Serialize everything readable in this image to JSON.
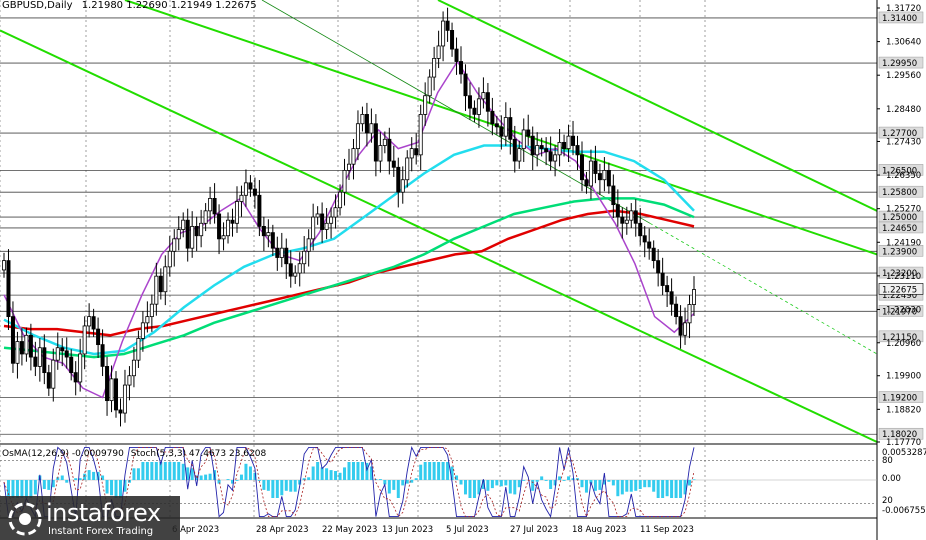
{
  "header": {
    "symbol": "GBPUSD,Daily",
    "ohlc": "1.21980 1.22690 1.21949 1.22675"
  },
  "subwindow": {
    "osma": "OsMA(12,26,9) -0.0009790",
    "stoch": "Stoch(5,3,3) 47.4673 23.6208"
  },
  "logo": {
    "name": "instaforex",
    "tagline": "Instant Forex Trading"
  },
  "colors": {
    "green_channel": "#22dd00",
    "ma_red": "#e00000",
    "ma_green": "#00dd77",
    "ma_cyan": "#22ddee",
    "ma_violet": "#aa44cc",
    "osma_bars": "#33ccee",
    "stoch_main": "#2222aa",
    "stoch_signal": "#aa2222",
    "current_price_bg": "#f0f0f0"
  },
  "chart_data": {
    "type": "candlestick",
    "symbol": "GBPUSD",
    "timeframe": "Daily",
    "price_axis_ticks": [
      "1.31720",
      "1.30640",
      "1.29560",
      "1.28480",
      "1.27430",
      "1.26350",
      "1.25270",
      "1.24190",
      "1.23110",
      "1.22030",
      "1.20960",
      "1.19900",
      "1.18820",
      "1.17770"
    ],
    "level_labels": [
      "1.31400",
      "1.29950",
      "1.27700",
      "1.26500",
      "1.25800",
      "1.25000",
      "1.24650",
      "1.23900",
      "1.23200",
      "1.22490",
      "1.21970",
      "1.21150",
      "1.19200",
      "1.18020"
    ],
    "current_price": "1.22675",
    "date_axis_ticks": [
      "6 Apr 2023",
      "28 Apr 2023",
      "22 May 2023",
      "13 Jun 2023",
      "5 Jul 2023",
      "27 Jul 2023",
      "18 Aug 2023",
      "11 Sep 2023"
    ],
    "subwindow_axis_ticks": [
      "0.0053287",
      "80",
      "0.00",
      "20",
      "-0.006755"
    ],
    "stoch_levels": [
      80,
      20
    ],
    "closes": [
      1.236,
      1.218,
      1.203,
      1.21,
      1.206,
      1.212,
      1.205,
      1.202,
      1.208,
      1.2,
      1.195,
      1.204,
      1.208,
      1.207,
      1.205,
      1.2,
      1.197,
      1.206,
      1.215,
      1.218,
      1.214,
      1.209,
      1.202,
      1.191,
      1.198,
      1.188,
      1.187,
      1.196,
      1.199,
      1.204,
      1.211,
      1.216,
      1.218,
      1.222,
      1.231,
      1.226,
      1.234,
      1.239,
      1.243,
      1.246,
      1.249,
      1.24,
      1.247,
      1.244,
      1.248,
      1.252,
      1.256,
      1.251,
      1.243,
      1.244,
      1.249,
      1.248,
      1.255,
      1.257,
      1.261,
      1.259,
      1.257,
      1.247,
      1.244,
      1.245,
      1.24,
      1.237,
      1.24,
      1.235,
      1.231,
      1.232,
      1.235,
      1.239,
      1.243,
      1.25,
      1.251,
      1.246,
      1.248,
      1.25,
      1.253,
      1.258,
      1.265,
      1.267,
      1.272,
      1.28,
      1.283,
      1.277,
      1.28,
      1.268,
      1.273,
      1.275,
      1.268,
      1.266,
      1.258,
      1.262,
      1.269,
      1.272,
      1.27,
      1.283,
      1.289,
      1.295,
      1.301,
      1.305,
      1.313,
      1.31,
      1.304,
      1.3,
      1.296,
      1.289,
      1.285,
      1.283,
      1.288,
      1.29,
      1.284,
      1.28,
      1.279,
      1.276,
      1.282,
      1.275,
      1.268,
      1.272,
      1.278,
      1.276,
      1.27,
      1.273,
      1.272,
      1.271,
      1.268,
      1.27,
      1.274,
      1.272,
      1.276,
      1.273,
      1.27,
      1.262,
      1.26,
      1.268,
      1.264,
      1.262,
      1.265,
      1.26,
      1.254,
      1.25,
      1.248,
      1.249,
      1.252,
      1.248,
      1.244,
      1.242,
      1.24,
      1.236,
      1.232,
      1.228,
      1.226,
      1.222,
      1.218,
      1.212,
      1.216,
      1.2219,
      1.2267
    ],
    "series": [
      {
        "name": "MA red",
        "values": [
          1.215,
          1.214,
          1.214,
          1.213,
          1.212,
          1.214,
          1.215,
          1.217,
          1.219,
          1.221,
          1.223,
          1.225,
          1.227,
          1.229,
          1.232,
          1.234,
          1.236,
          1.238,
          1.239,
          1.243,
          1.246,
          1.249,
          1.251,
          1.252,
          1.251,
          1.249,
          1.247
        ]
      },
      {
        "name": "MA green",
        "values": [
          1.208,
          1.207,
          1.206,
          1.205,
          1.206,
          1.209,
          1.212,
          1.216,
          1.219,
          1.222,
          1.225,
          1.228,
          1.231,
          1.234,
          1.238,
          1.243,
          1.247,
          1.251,
          1.253,
          1.255,
          1.256,
          1.256,
          1.254,
          1.25
        ]
      },
      {
        "name": "MA cyan",
        "values": [
          1.217,
          1.212,
          1.208,
          1.206,
          1.207,
          1.213,
          1.221,
          1.228,
          1.234,
          1.238,
          1.24,
          1.243,
          1.25,
          1.257,
          1.264,
          1.27,
          1.273,
          1.273,
          1.272,
          1.271,
          1.271,
          1.268,
          1.262,
          1.252
        ]
      },
      {
        "name": "MA violet",
        "values": [
          1.225,
          1.212,
          1.205,
          1.203,
          1.195,
          1.192,
          1.21,
          1.225,
          1.238,
          1.245,
          1.247,
          1.252,
          1.256,
          1.246,
          1.238,
          1.236,
          1.245,
          1.258,
          1.27,
          1.278,
          1.272,
          1.274,
          1.29,
          1.3,
          1.29,
          1.282,
          1.275,
          1.27,
          1.272,
          1.268,
          1.258,
          1.248,
          1.235,
          1.218,
          1.213,
          1.219
        ]
      }
    ]
  }
}
